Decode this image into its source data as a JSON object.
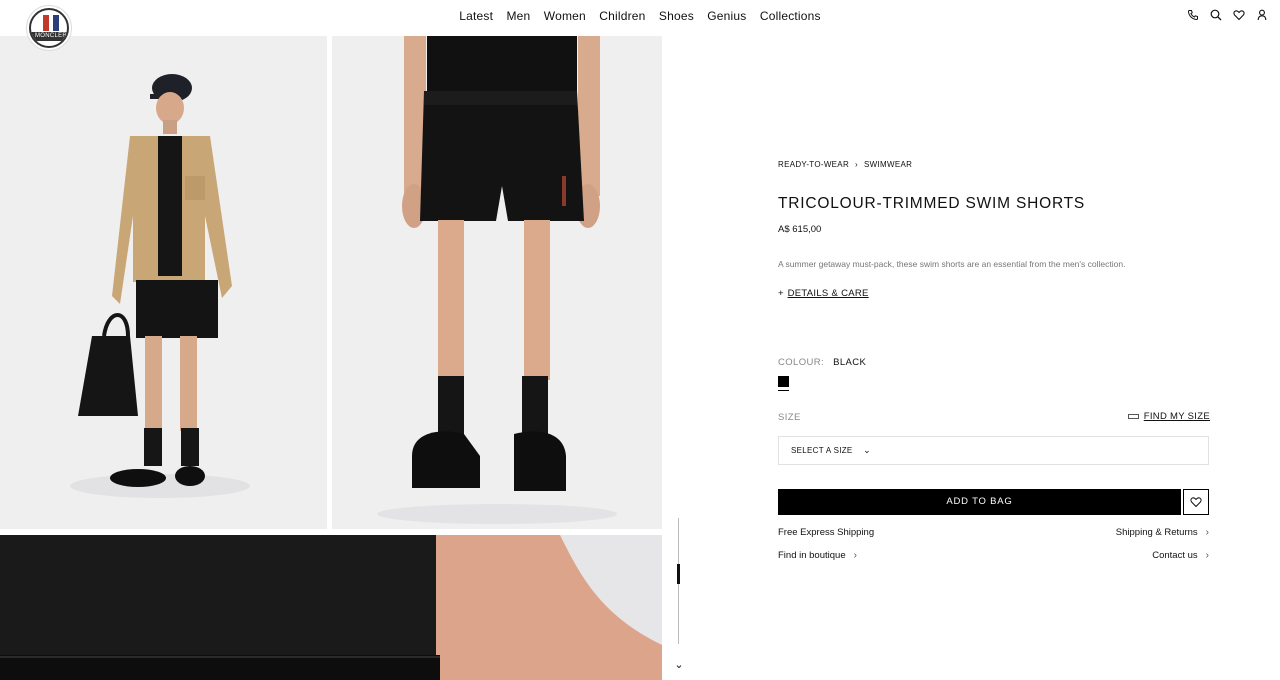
{
  "header": {
    "logo_text": "MONCLER",
    "nav": [
      "Latest",
      "Men",
      "Women",
      "Children",
      "Shoes",
      "Genius",
      "Collections"
    ],
    "utility_icons": [
      "phone-icon",
      "search-icon",
      "heart-icon",
      "account-icon"
    ]
  },
  "breadcrumb": {
    "items": [
      "READY-TO-WEAR",
      "SWIMWEAR"
    ],
    "separator": "›"
  },
  "product": {
    "title": "TRICOLOUR-TRIMMED SWIM SHORTS",
    "price": "A$ 615,00",
    "description": "A summer getaway must-pack, these swim shorts are an essential from the men's collection.",
    "details_toggle": "+",
    "details_link": "DETAILS & CARE"
  },
  "colour": {
    "label": "COLOUR:",
    "value": "BLACK",
    "swatch_hex": "#000000"
  },
  "size": {
    "label": "SIZE",
    "find_link": "FIND MY SIZE",
    "select_value": "SELECT A SIZE",
    "chevron": "⌄"
  },
  "actions": {
    "add_to_bag": "ADD TO BAG",
    "wishlist_icon": "heart-icon"
  },
  "services": {
    "free_shipping": "Free Express Shipping",
    "shipping_returns": "Shipping & Returns",
    "find_boutique": "Find in boutique",
    "contact_us": "Contact us",
    "arrow": "›"
  },
  "gallery": {
    "images": [
      "model-full-look-image",
      "model-shorts-closeup-image",
      "fabric-detail-image"
    ],
    "scroll_icon": "⌄"
  },
  "colors": {
    "primary": "#000000",
    "background": "#ffffff",
    "image_bg": "#efeff0",
    "muted_text": "#777777"
  }
}
